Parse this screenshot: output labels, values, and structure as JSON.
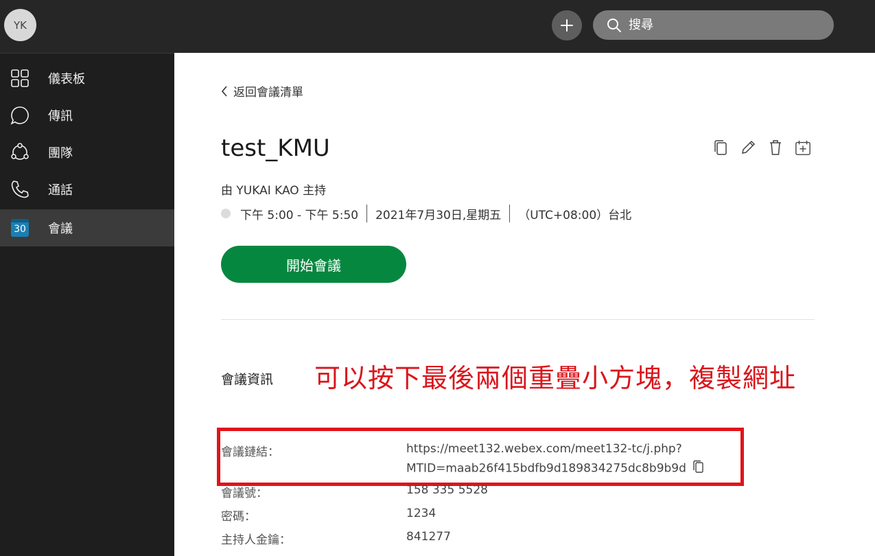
{
  "header": {
    "avatar_initials": "YK",
    "search_placeholder": "搜尋"
  },
  "sidebar": {
    "items": [
      {
        "label": "儀表板",
        "icon": "dashboard-grid-icon"
      },
      {
        "label": "傳訊",
        "icon": "chat-bubble-icon"
      },
      {
        "label": "團隊",
        "icon": "teams-icon"
      },
      {
        "label": "通話",
        "icon": "phone-icon"
      },
      {
        "label": "會議",
        "icon": "calendar-icon",
        "active": true,
        "badge": "30"
      }
    ]
  },
  "meeting": {
    "back_label": "返回會議清單",
    "title": "test_KMU",
    "host": "由 YUKAI KAO 主持",
    "time_range": "下午 5:00 - 下午 5:50",
    "date": "2021年7月30日,星期五",
    "timezone": "（UTC+08:00）台北",
    "start_button": "開始會議",
    "info_title": "會議資訊",
    "annotation": "可以按下最後兩個重疊小方塊，複製網址",
    "annotation_color": "#d9161c",
    "details": [
      {
        "label": "會議鏈結：",
        "value_line1": "https://meet132.webex.com/meet132-tc/j.php?",
        "value_line2": "MTID=maab26f415bdfb9d189834275dc8b9b9d"
      },
      {
        "label": "會議號：",
        "value": "158 335 5528"
      },
      {
        "label": "密碼：",
        "value": "1234"
      },
      {
        "label": "主持人金鑰：",
        "value": "841277"
      }
    ]
  },
  "colors": {
    "start_button": "#06873f",
    "highlight_border": "#e1131a",
    "sidebar_bg": "#1e1e1e",
    "topbar_bg": "#262626"
  }
}
